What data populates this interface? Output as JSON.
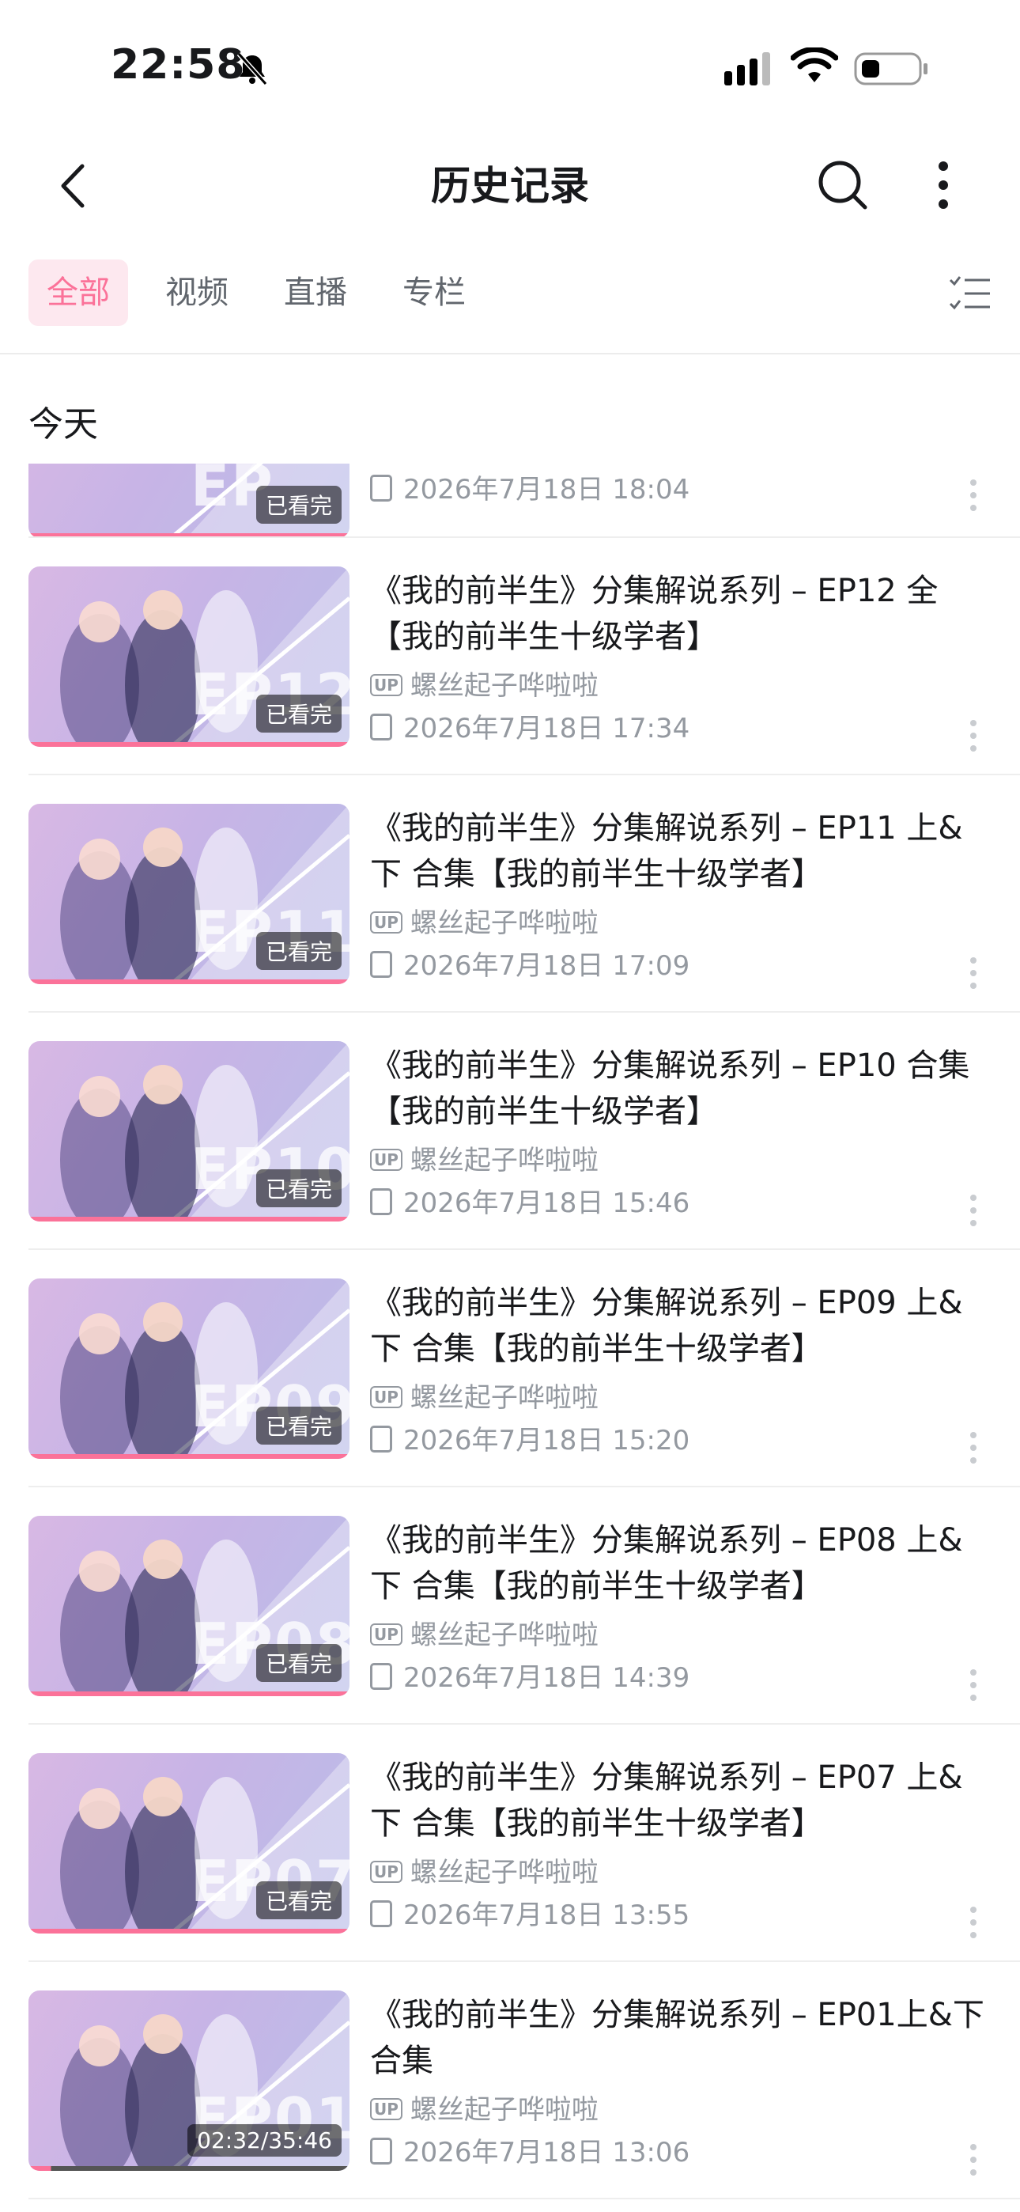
{
  "status_bar": {
    "time": "22:58"
  },
  "nav": {
    "title": "历史记录"
  },
  "tabs": [
    {
      "label": "全部",
      "active": true
    },
    {
      "label": "视频",
      "active": false
    },
    {
      "label": "直播",
      "active": false
    },
    {
      "label": "专栏",
      "active": false
    }
  ],
  "section": {
    "title": "今天"
  },
  "colors": {
    "accent": "#fb7299",
    "text": "#18191c",
    "secondary": "#9499a0"
  },
  "first_item": {
    "badge": "已看完",
    "ep": "EP",
    "time": "2026年7月18日 18:04"
  },
  "items": [
    {
      "title": "《我的前半生》分集解说系列 – EP12 全【我的前半生十级学者】",
      "ep": "EP12",
      "badge": "已看完",
      "up_tag": "UP",
      "author": "螺丝起子哗啦啦",
      "time": "2026年7月18日 17:34",
      "progress": 1.0
    },
    {
      "title": "《我的前半生》分集解说系列 – EP11 上&下 合集【我的前半生十级学者】",
      "ep": "EP11",
      "badge": "已看完",
      "up_tag": "UP",
      "author": "螺丝起子哗啦啦",
      "time": "2026年7月18日 17:09",
      "progress": 1.0
    },
    {
      "title": "《我的前半生》分集解说系列 – EP10 合集【我的前半生十级学者】",
      "ep": "EP10",
      "badge": "已看完",
      "up_tag": "UP",
      "author": "螺丝起子哗啦啦",
      "time": "2026年7月18日 15:46",
      "progress": 1.0
    },
    {
      "title": "《我的前半生》分集解说系列 – EP09 上&下 合集【我的前半生十级学者】",
      "ep": "EP09",
      "badge": "已看完",
      "up_tag": "UP",
      "author": "螺丝起子哗啦啦",
      "time": "2026年7月18日 15:20",
      "progress": 1.0
    },
    {
      "title": "《我的前半生》分集解说系列 – EP08 上&下 合集【我的前半生十级学者】",
      "ep": "EP08",
      "badge": "已看完",
      "up_tag": "UP",
      "author": "螺丝起子哗啦啦",
      "time": "2026年7月18日 14:39",
      "progress": 1.0
    },
    {
      "title": "《我的前半生》分集解说系列 – EP07 上&下 合集【我的前半生十级学者】",
      "ep": "EP07",
      "badge": "已看完",
      "up_tag": "UP",
      "author": "螺丝起子哗啦啦",
      "time": "2026年7月18日 13:55",
      "progress": 1.0
    },
    {
      "title": "《我的前半生》分集解说系列 – EP01上&下 合集",
      "ep": "EP01",
      "badge": "02:32/35:46",
      "up_tag": "UP",
      "author": "螺丝起子哗啦啦",
      "time": "2026年7月18日 13:06",
      "progress": 0.07
    }
  ]
}
